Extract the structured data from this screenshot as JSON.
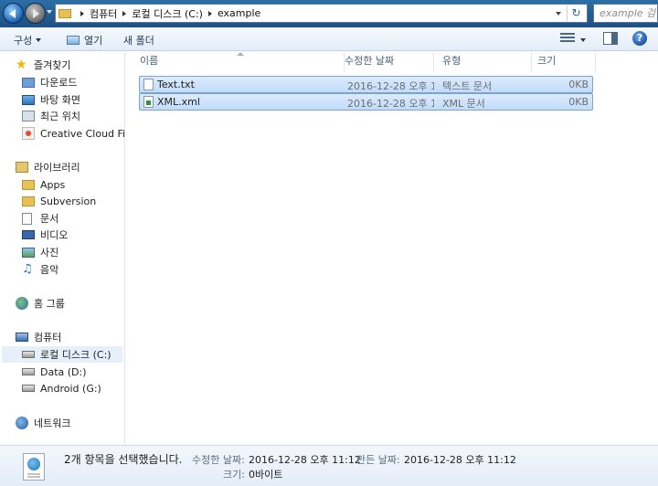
{
  "address_bar": {
    "breadcrumbs": [
      "컴퓨터",
      "로컬 디스크 (C:)",
      "example"
    ],
    "search_placeholder": "example 검색"
  },
  "toolbar": {
    "organize_label": "구성",
    "open_label": "열기",
    "new_folder_label": "새 폴더"
  },
  "nav": {
    "favorites": {
      "label": "즐겨찾기",
      "items": [
        "다운로드",
        "바탕 화면",
        "최근 위치",
        "Creative Cloud Files"
      ]
    },
    "libraries": {
      "label": "라이브러리",
      "items": [
        "Apps",
        "Subversion",
        "문서",
        "비디오",
        "사진",
        "음악"
      ]
    },
    "homegroup": {
      "label": "홈 그룹"
    },
    "computer": {
      "label": "컴퓨터",
      "items": [
        "로컬 디스크 (C:)",
        "Data (D:)",
        "Android (G:)"
      ]
    },
    "network": {
      "label": "네트워크"
    }
  },
  "columns": {
    "name": "이름",
    "modified": "수정한 날짜",
    "type": "유형",
    "size": "크기"
  },
  "files": [
    {
      "name": "Text.txt",
      "modified": "2016-12-28 오후 1...",
      "type": "텍스트 문서",
      "size": "0KB",
      "icon": "text-file-icon"
    },
    {
      "name": "XML.xml",
      "modified": "2016-12-28 오후 1...",
      "type": "XML 문서",
      "size": "0KB",
      "icon": "xml-file-icon"
    }
  ],
  "details": {
    "selection_text": "2개 항목을 선택했습니다.",
    "modified_label": "수정한 날짜:",
    "modified_value": "2016-12-28 오후 11:12",
    "created_label": "만든 날짜:",
    "created_value": "2016-12-28 오후 11:12",
    "size_label": "크기:",
    "size_value": "0바이트"
  }
}
